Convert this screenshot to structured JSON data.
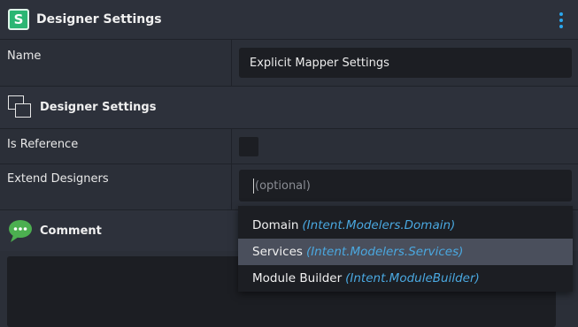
{
  "header": {
    "app_icon_letter": "S",
    "title": "Designer Settings"
  },
  "fields": {
    "name_label": "Name",
    "name_value": "Explicit Mapper Settings",
    "is_reference_label": "Is Reference",
    "is_reference_checked": false,
    "extend_designers_label": "Extend Designers",
    "extend_designers_placeholder": "(optional)"
  },
  "sections": {
    "designer_settings_title": "Designer Settings",
    "comment_title": "Comment"
  },
  "dropdown": {
    "options": [
      {
        "label": "Domain",
        "hint": "(Intent.Modelers.Domain)",
        "selected": false
      },
      {
        "label": "Services",
        "hint": "(Intent.Modelers.Services)",
        "selected": true
      },
      {
        "label": "Module Builder",
        "hint": "(Intent.ModuleBuilder)",
        "selected": false
      }
    ]
  },
  "icons": {
    "app": "app-logo-icon",
    "menu": "kebab-menu-icon",
    "section": "windows-icon",
    "comment": "speech-bubble-icon"
  },
  "colors": {
    "accent": "#2aa7ee",
    "hint_text": "#4aa8e0",
    "app_icon": "#2bb673",
    "comment_icon": "#4caf50"
  }
}
